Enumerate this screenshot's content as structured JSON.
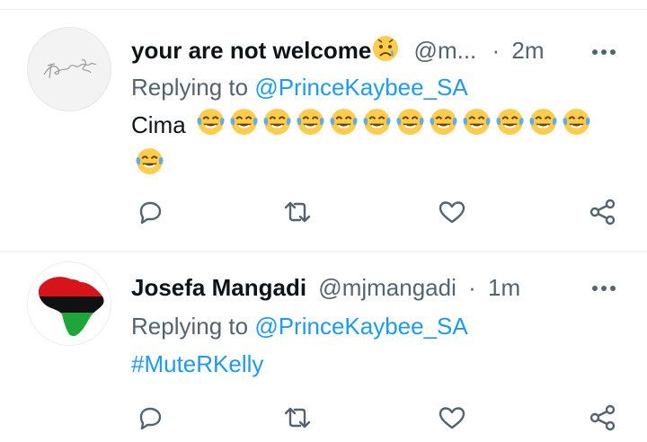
{
  "colors": {
    "name": "#0f1419",
    "meta": "#536471",
    "link": "#1d9bf0",
    "icon": "#536471",
    "divider": "#eff3f4"
  },
  "tweets": [
    {
      "name": "your are not welcome",
      "name_emoji_icon": "sad-tear-face-icon",
      "handle": "@m...",
      "dot": "·",
      "time": "2m",
      "replying_prefix": "Replying to ",
      "replying_to": "@PrinceKaybee_SA",
      "text": "Cima",
      "emoji_icon": "face-with-tears-of-joy-icon",
      "emoji_count": 13,
      "avatar_text": "TeamKingOg"
    },
    {
      "name": "Josefa Mangadi",
      "handle": "@mjmangadi",
      "dot": "·",
      "time": "1m",
      "replying_prefix": "Replying to ",
      "replying_to": "@PrinceKaybee_SA",
      "text": "#MuteRKelly",
      "avatar_icon": "africa-flag-map-icon"
    }
  ],
  "actions": [
    "reply-icon",
    "retweet-icon",
    "like-icon",
    "share-icon"
  ]
}
